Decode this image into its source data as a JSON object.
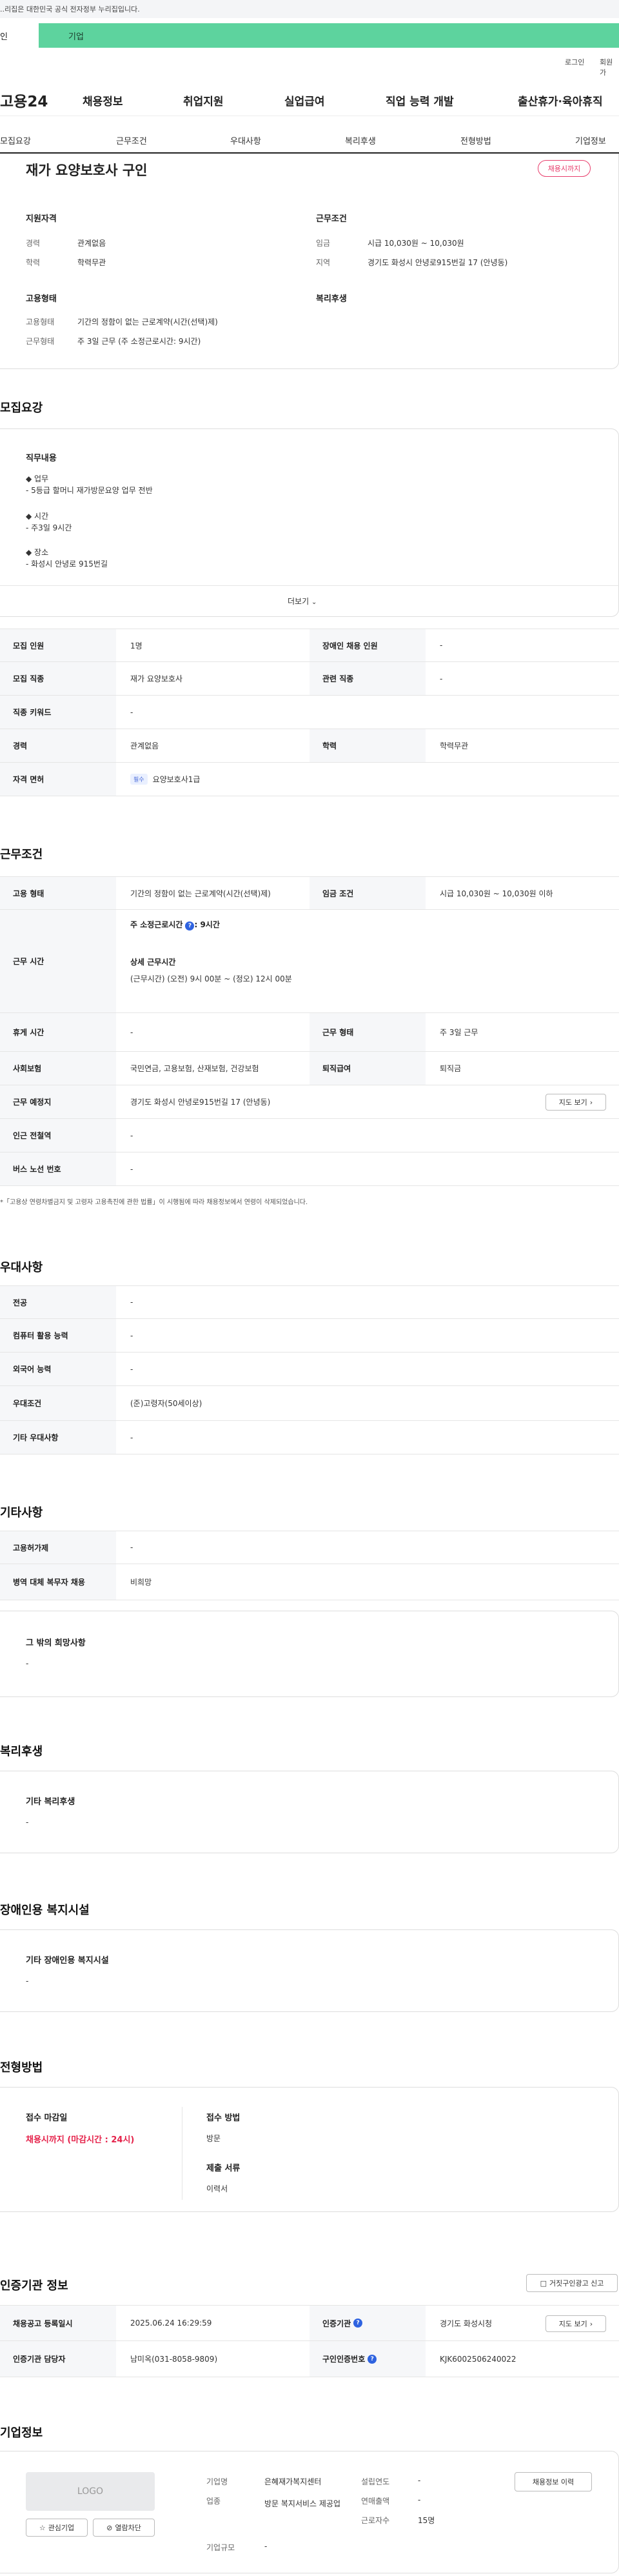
{
  "gov_bar": {
    "text": "..리집은 대한민국 공식 전자정부 누리집입니다."
  },
  "top_tabs": {
    "personal": "인",
    "company": "기업"
  },
  "util": {
    "login": "로그인",
    "join": "회원가"
  },
  "gnb": {
    "logo": "고용24",
    "items": [
      "채용정보",
      "취업지원",
      "실업급여",
      "직업 능력 개발",
      "출산휴가·육아휴직"
    ]
  },
  "subnav": {
    "items": [
      "모집요강",
      "근무조건",
      "우대사항",
      "복리후생",
      "전형방법",
      "기업정보"
    ]
  },
  "summary": {
    "title": "재가 요양보호사 구인",
    "status_pill": "채용시까지",
    "qual_title": "지원자격",
    "career_label": "경력",
    "career_value": "관계없음",
    "edu_label": "학력",
    "edu_value": "학력무관",
    "cond_title": "근무조건",
    "wage_label": "임금",
    "wage_value": "시급 10,030원 ~ 10,030원",
    "area_label": "지역",
    "area_value": "경기도 화성시 안녕로915번길 17 (안녕동)",
    "emp_title": "고용형태",
    "emp_type_label": "고용형태",
    "emp_type_value": "기간의 정함이 없는 근로계약(시간(선택)제)",
    "work_type_label": "근무형태",
    "work_type_value": "주 3일 근무 (주 소정근로시간: 9시간)",
    "welfare_title": "복리후생"
  },
  "recruit": {
    "title": "모집요강",
    "duty_title": "직무내용",
    "duty_lines": [
      "◆ 업무",
      "- 5등급 할머니 재가방문요양 업무 전반",
      "",
      "◆ 시간",
      "- 주3일 9시간",
      "",
      "◆ 장소",
      "- 화성시 안녕로 915번길"
    ],
    "more": "더보기",
    "rows": [
      {
        "h1": "모집 인원",
        "v1": "1명",
        "h2": "장애인 채용 인원",
        "v2": "-"
      },
      {
        "h1": "모집 직종",
        "v1": "재가 요양보호사",
        "h2": "관련 직종",
        "v2": "-"
      },
      {
        "h1": "직종 키워드",
        "v1": "-"
      },
      {
        "h1": "경력",
        "v1": "관계없음",
        "h2": "학력",
        "v2": "학력무관"
      },
      {
        "h1": "자격 면허",
        "tag": "필수",
        "v1": "요양보호사1급"
      }
    ]
  },
  "work": {
    "title": "근무조건",
    "emp_type_h": "고용 형태",
    "emp_type_v": "기간의 정함이 없는 근로계약(시간(선택)제)",
    "wage_h": "임금 조건",
    "wage_v": "시급 10,030원 ~ 10,030원 이하",
    "hours_h": "근무 시간",
    "hours_weekly": "주 소정근로시간",
    "hours_weekly_value": ": 9시간",
    "hours_detail_title": "상세 근무시간",
    "hours_detail": "(근무시간) (오전) 9시 00분 ~ (정오) 12시 00분",
    "break_h": "휴게 시간",
    "break_v": "-",
    "shift_h": "근무 형태",
    "shift_v": "주 3일 근무",
    "insurance_h": "사회보험",
    "insurance_v": "국민연금, 고용보험, 산재보험, 건강보험",
    "severance_h": "퇴직급여",
    "severance_v": "퇴직금",
    "place_h": "근무 예정지",
    "place_v": "경기도 화성시 안녕로915번길 17 (안녕동)",
    "map_btn": "지도 보기",
    "subway_h": "인근 전철역",
    "subway_v": "-",
    "bus_h": "버스 노선 번호",
    "bus_v": "-",
    "note": "*「고용상 연령차별금지 및 고령자 고용촉진에 관한 법률」이 시행됨에 따라 채용정보에서 연령이 삭제되었습니다."
  },
  "pref": {
    "title": "우대사항",
    "rows": [
      {
        "h": "전공",
        "v": "-"
      },
      {
        "h": "컴퓨터 활용 능력",
        "v": "-"
      },
      {
        "h": "외국어 능력",
        "v": "-"
      },
      {
        "h": "우대조건",
        "v": "(준)고령자(50세이상)"
      },
      {
        "h": "기타 우대사항",
        "v": "-"
      }
    ]
  },
  "etc": {
    "title": "기타사항",
    "rows": [
      {
        "h": "고용허가제",
        "v": "-"
      },
      {
        "h": "병역 대체 복무자 채용",
        "v": "비희망"
      }
    ],
    "other_title": "그 밖의 희망사항",
    "other_value": "-"
  },
  "welfare": {
    "title": "복리후생",
    "box_title": "기타 복리후생",
    "box_value": "-"
  },
  "disabled": {
    "title": "장애인용 복지시설",
    "box_title": "기타 장애인용 복지시설",
    "box_value": "-"
  },
  "screening": {
    "title": "전형방법",
    "deadline_title": "접수 마감일",
    "deadline_value": "채용시까지 (마감시간 : 24시)",
    "method_title": "접수 방법",
    "method_value": "방문",
    "docs_title": "제출 서류",
    "docs_value": "이력서"
  },
  "cert": {
    "title": "인증기관 정보",
    "report_btn": "거짓구인광고 신고",
    "reg_date_h": "채용공고 등록일시",
    "reg_date_v": "2025.06.24 16:29:59",
    "org_h": "인증기관",
    "org_v": "경기도 화성시청",
    "map_btn": "지도 보기",
    "manager_h": "인증기관 담당자",
    "manager_v": "남미옥(031-8058-9809)",
    "id_h": "구인인증번호",
    "id_v": "KJK6002506240022"
  },
  "company": {
    "title": "기업정보",
    "logo_text": "LOGO",
    "fav_btn": "관심기업",
    "block_btn": "열람차단",
    "name_label": "기업명",
    "name_value": "은혜재가복지센터",
    "industry_label": "업종",
    "industry_value": "방문 복지서비스 제공업",
    "size_label": "기업규모",
    "size_value": "-",
    "founded_label": "설립연도",
    "founded_value": "-",
    "revenue_label": "연매출액",
    "revenue_value": "-",
    "employees_label": "근로자수",
    "employees_value": "15명",
    "history_btn": "채용정보 이력"
  }
}
